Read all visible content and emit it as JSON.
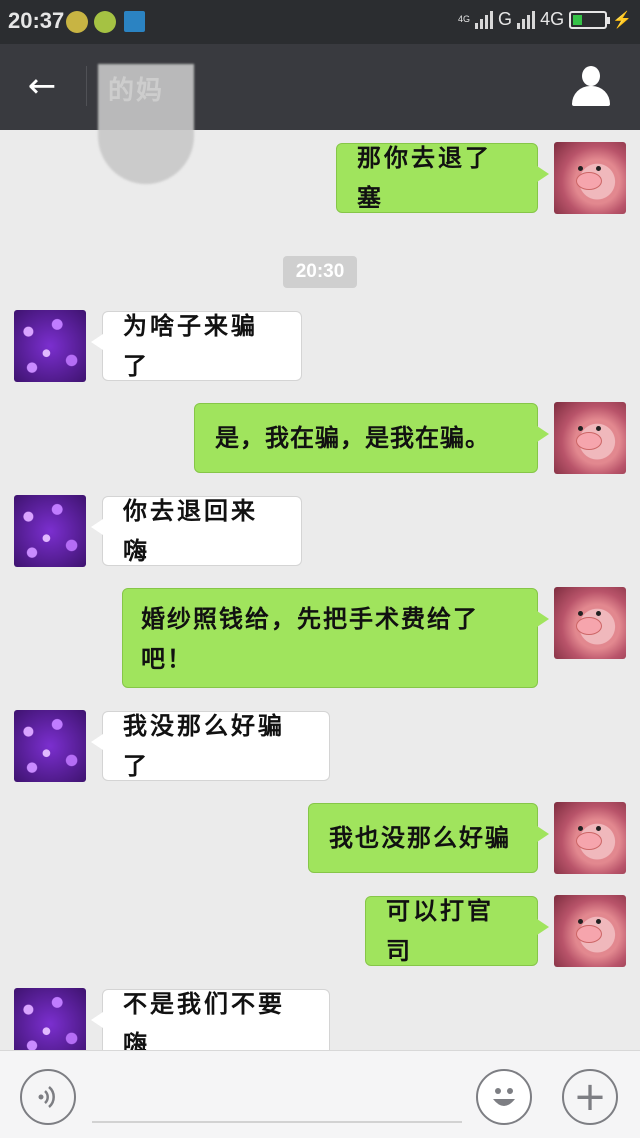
{
  "status_bar": {
    "time": "20:37",
    "network_small": "4G",
    "network_g": "G",
    "network_4g": "4G",
    "battery_level": 0.3,
    "charging_icon": "⚡"
  },
  "nav": {
    "title": "的妈",
    "back_icon": "←"
  },
  "timestamp": "20:30",
  "messages": [
    {
      "side": "right",
      "text": "那你去退了塞"
    },
    {
      "side": "left",
      "text": "为啥子来骗了"
    },
    {
      "side": "right",
      "text": "是，我在骗，是我在骗。"
    },
    {
      "side": "left",
      "text": "你去退回来嗨"
    },
    {
      "side": "right",
      "text": "婚纱照钱给，先把手术费给了吧！"
    },
    {
      "side": "left",
      "text": "我没那么好骗了"
    },
    {
      "side": "right",
      "text": "我也没那么好骗"
    },
    {
      "side": "right",
      "text": "可以打官司"
    },
    {
      "side": "left",
      "text": "不是我们不要嗨"
    }
  ],
  "input": {
    "voice_icon": "voice-icon",
    "emoji_icon": "emoji-icon",
    "plus_icon": "+"
  }
}
